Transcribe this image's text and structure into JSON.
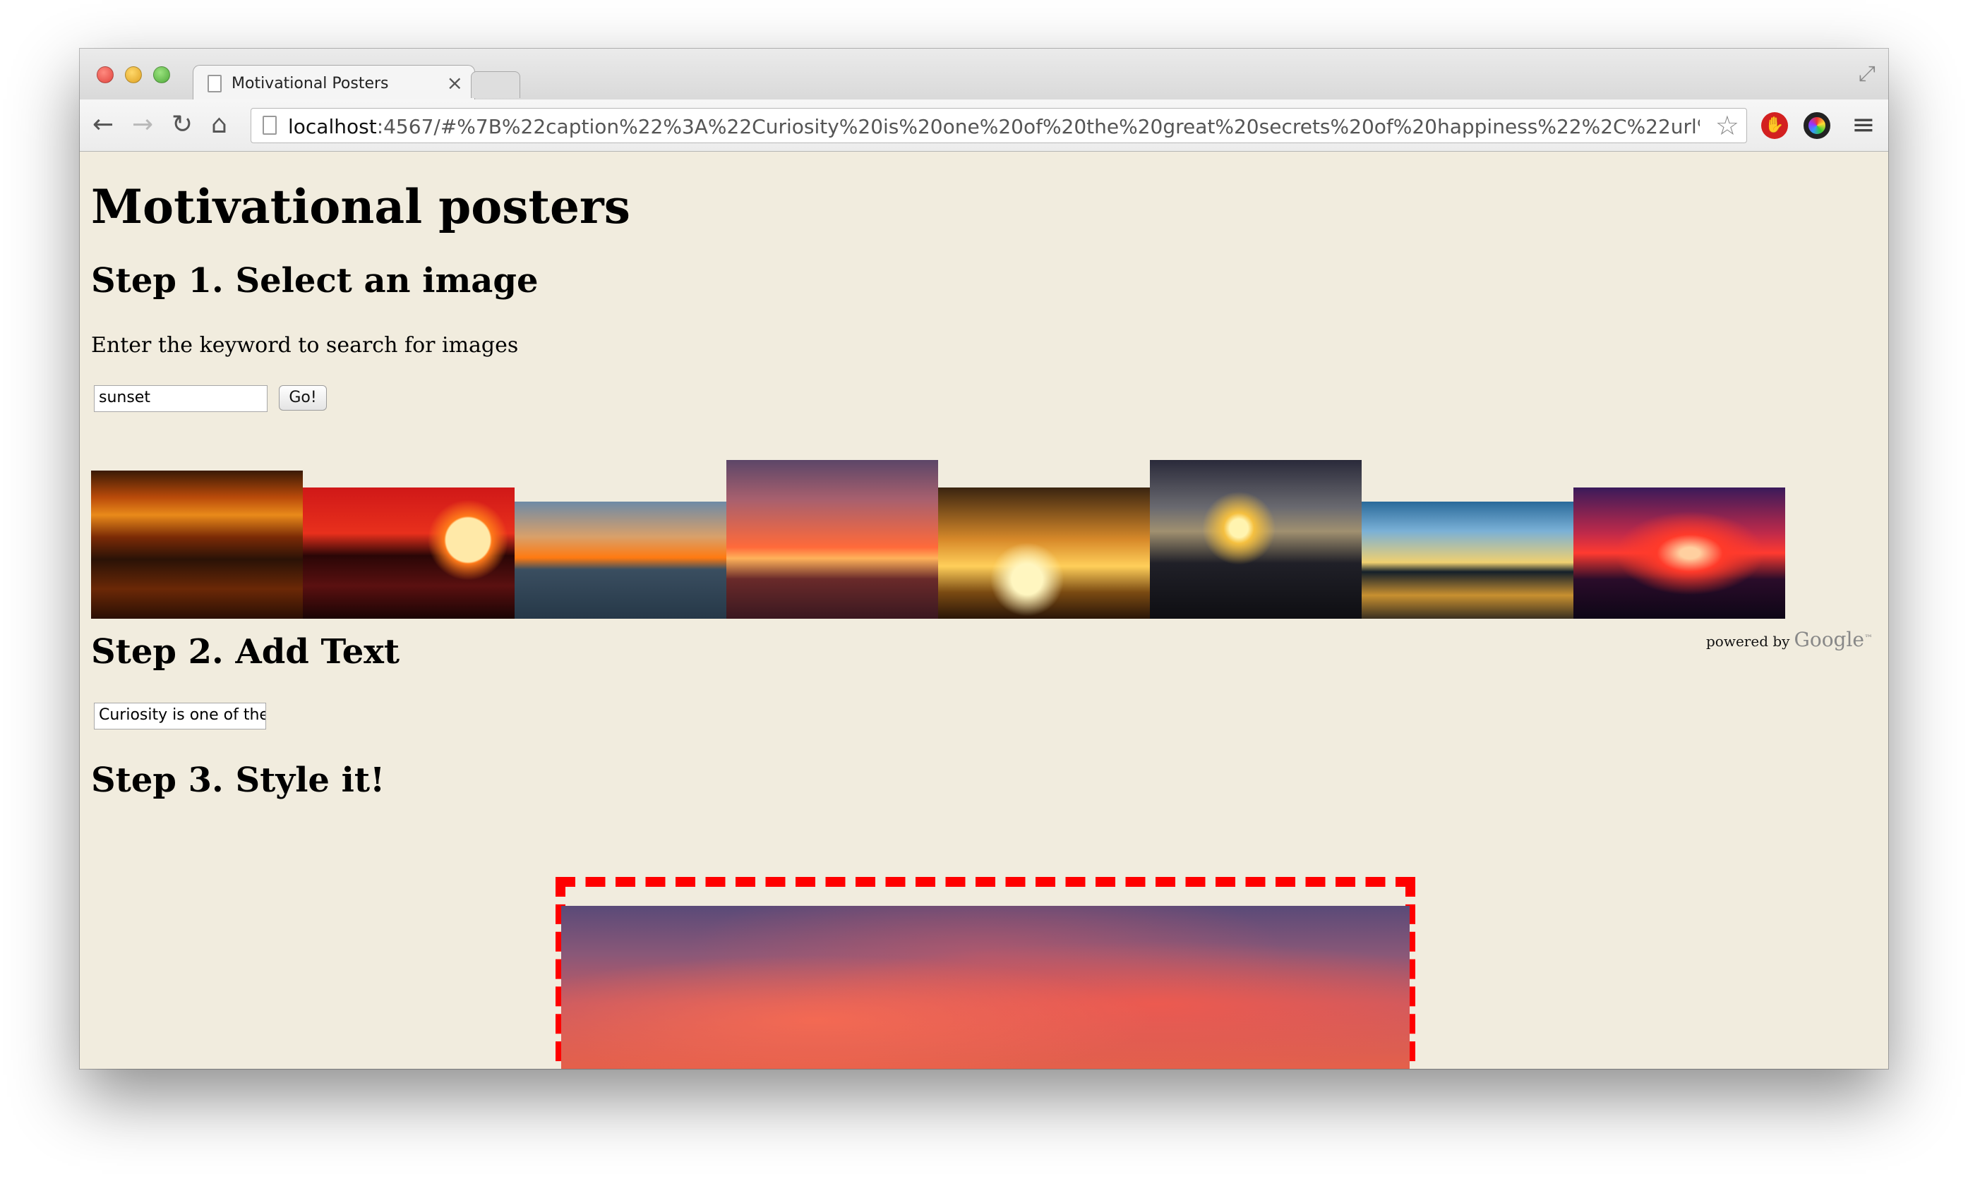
{
  "browser": {
    "tab_title": "Motivational Posters",
    "tab_close": "×",
    "url_host": "localhost",
    "url_rest": ":4567/#%7B%22caption%22%3A%22Curiosity%20is%20one%20of%20the%20great%20secrets%20of%20happiness%22%2C%22url%22%3A%2…",
    "icons": [
      "back-icon",
      "forward-icon",
      "reload-icon",
      "home-icon",
      "star-icon",
      "menu-icon"
    ]
  },
  "page": {
    "title": "Motivational posters",
    "step1": {
      "heading": "Step 1. Select an image",
      "instruction": "Enter the keyword to search for images",
      "keyword_value": "sunset",
      "go_label": "Go!",
      "thumbnail_count": 8
    },
    "powered_by": "powered by",
    "google": "Google",
    "google_tm": "™",
    "step2": {
      "heading": "Step 2. Add Text",
      "caption_value": "Curiosity is one of the"
    },
    "step3": {
      "heading": "Step 3. Style it!"
    },
    "colors": {
      "page_background": "#f1ecde",
      "poster_border": "#ff0000"
    }
  }
}
